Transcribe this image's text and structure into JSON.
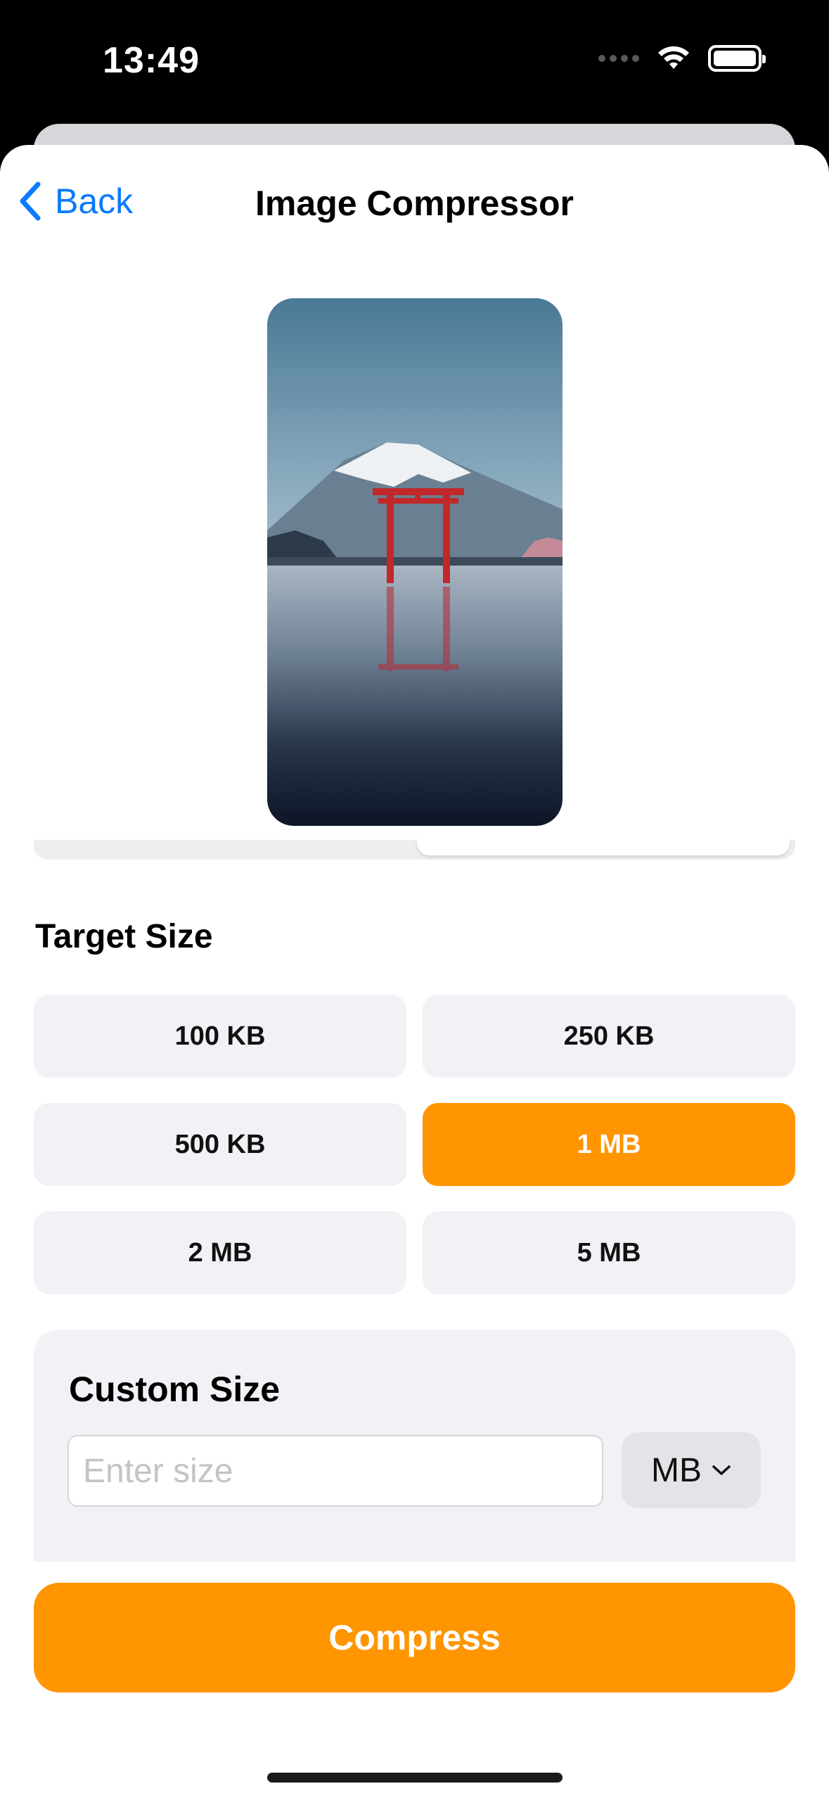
{
  "status_bar": {
    "time": "13:49"
  },
  "nav": {
    "back_label": "Back",
    "title": "Image Compressor"
  },
  "target_size": {
    "heading": "Target Size",
    "options": [
      {
        "label": "100 KB",
        "selected": false
      },
      {
        "label": "250 KB",
        "selected": false
      },
      {
        "label": "500 KB",
        "selected": false
      },
      {
        "label": "1 MB",
        "selected": true
      },
      {
        "label": "2 MB",
        "selected": false
      },
      {
        "label": "5 MB",
        "selected": false
      }
    ]
  },
  "custom_size": {
    "heading": "Custom Size",
    "input_value": "",
    "input_placeholder": "Enter size",
    "unit_selected": "MB"
  },
  "compress_label": "Compress",
  "colors": {
    "accent": "#ff9500",
    "link": "#0a7aff",
    "chip_bg": "#f1f1f6"
  }
}
